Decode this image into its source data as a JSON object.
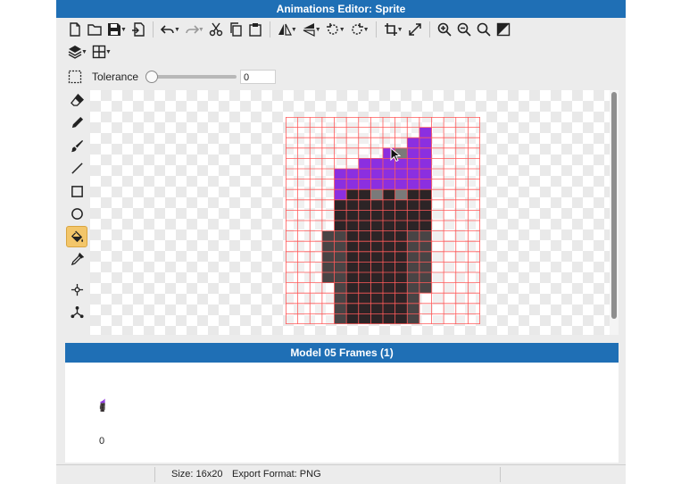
{
  "window": {
    "title": "Animations Editor: Sprite"
  },
  "toolbar_row1": [
    "new-file",
    "open-folder",
    "save",
    "export",
    "undo",
    "redo",
    "cut",
    "copy",
    "paste",
    "flip-horizontal",
    "flip-vertical",
    "rotate-left",
    "rotate-right",
    "crop",
    "resize",
    "zoom-in",
    "zoom-out",
    "zoom-fit",
    "toggle-transparency"
  ],
  "toolbar_row2": [
    "layers",
    "grid"
  ],
  "tolerance": {
    "label": "Tolerance",
    "value": "0",
    "level": 0
  },
  "tools": [
    "eraser",
    "pencil",
    "brush",
    "line",
    "rectangle",
    "ellipse",
    "fill",
    "eyedropper",
    "move-node",
    "skeleton"
  ],
  "active_tool": "fill",
  "sprite": {
    "width": 16,
    "height": 20,
    "palette": {
      "P": "#8b2fe0",
      "L": "#7a7a7a",
      "D": "#2c2426",
      "G": "#494445",
      "W": "#ffffff"
    },
    "rows": [
      "................",
      "...........P....",
      "..........PP....",
      "........PLPP....",
      "......PPPPPP....",
      "....PPPPPPPP....",
      "....PPPPPPPP....",
      "....PDDLDLDD....",
      "....DDDDDDDD....",
      "....DDDDDDDD....",
      "....DDDDDDDD....",
      "...GGDDDDDGG....",
      "...GGDDDDDGG....",
      "...GGDDDDDGG....",
      "...GGDDDDDGG....",
      "...GGDDDDDGG....",
      "....GDDDDDGG....",
      "....GDDDDDG.....",
      "....GDDDDDG.....",
      "....GDDDDDG....."
    ]
  },
  "frames": {
    "title": "Model 05 Frames (1)",
    "items": [
      {
        "index": "0"
      }
    ]
  },
  "status": {
    "size": "Size: 16x20",
    "export_format": "Export Format: PNG"
  },
  "colors": {
    "accent": "#1f6fb5",
    "grid": "#ff5a5a",
    "active_tool": "#f3c66a"
  }
}
